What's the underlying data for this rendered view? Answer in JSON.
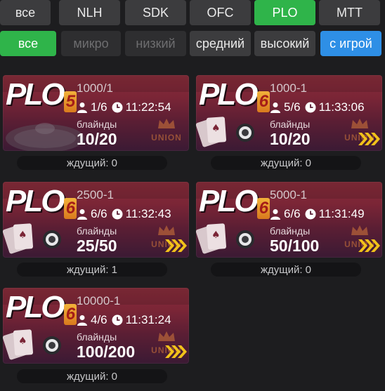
{
  "game_tabs": [
    {
      "label": "все",
      "active": false
    },
    {
      "label": "NLH",
      "active": false
    },
    {
      "label": "SDK",
      "active": false
    },
    {
      "label": "OFC",
      "active": false
    },
    {
      "label": "PLO",
      "active": true
    },
    {
      "label": "MTT",
      "active": false
    }
  ],
  "stake_tabs": [
    {
      "label": "все",
      "state": "active"
    },
    {
      "label": "микро",
      "state": "disabled"
    },
    {
      "label": "низкий",
      "state": "disabled"
    },
    {
      "label": "средний",
      "state": "normal"
    },
    {
      "label": "высокий",
      "state": "normal"
    },
    {
      "label": "с игрой",
      "state": "highlighted"
    }
  ],
  "tables": [
    {
      "logo_text": "PLO",
      "logo_badge": "5",
      "buyin": "1000/1",
      "players": "1/6",
      "time": "11:22:54",
      "blinds_label": "блайнды",
      "blinds": "10/20",
      "waiting": "ждущий: 0",
      "badge_text": "UNION",
      "has_arrows": false
    },
    {
      "logo_text": "PLO",
      "logo_badge": "6",
      "buyin": "1000-1",
      "players": "5/6",
      "time": "11:33:06",
      "blinds_label": "блайнды",
      "blinds": "10/20",
      "waiting": "ждущий: 0",
      "badge_text": "UNION",
      "has_arrows": true
    },
    {
      "logo_text": "PLO",
      "logo_badge": "6",
      "buyin": "2500-1",
      "players": "6/6",
      "time": "11:32:43",
      "blinds_label": "блайнды",
      "blinds": "25/50",
      "waiting": "ждущий: 1",
      "badge_text": "UNION",
      "has_arrows": true
    },
    {
      "logo_text": "PLO",
      "logo_badge": "6",
      "buyin": "5000-1",
      "players": "6/6",
      "time": "11:31:49",
      "blinds_label": "блайнды",
      "blinds": "50/100",
      "waiting": "ждущий: 0",
      "badge_text": "UNION",
      "has_arrows": true
    },
    {
      "logo_text": "PLO",
      "logo_badge": "6",
      "buyin": "10000-1",
      "players": "4/6",
      "time": "11:31:24",
      "blinds_label": "блайнды",
      "blinds": "100/200",
      "waiting": "ждущий: 0",
      "badge_text": "UNION",
      "has_arrows": true
    }
  ],
  "colors": {
    "background": "#1d1d1f",
    "tab_active": "#2fb44a",
    "tab_highlight": "#2e8fe6",
    "card_top": "#8a2e3c",
    "card_bottom": "#3b1a34",
    "arrow": "#f2c21a"
  },
  "icons": [
    "user-icon",
    "clock-icon",
    "crown-icon",
    "chevron-right-icon",
    "poker-chip-icon",
    "playing-cards-icon"
  ]
}
